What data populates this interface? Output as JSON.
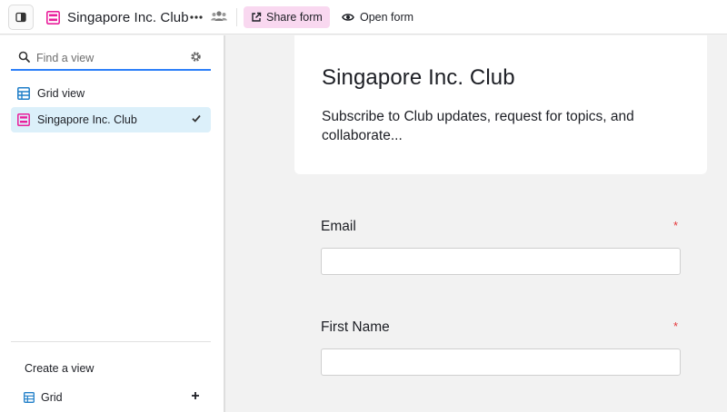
{
  "topbar": {
    "title": "Singapore Inc. Club",
    "share_label": "Share form",
    "open_label": "Open form"
  },
  "sidebar": {
    "search_placeholder": "Find a view",
    "views": [
      {
        "label": "Grid view",
        "icon": "grid-icon",
        "active": false
      },
      {
        "label": "Singapore Inc. Club",
        "icon": "form-icon",
        "active": true
      }
    ],
    "create_title": "Create a view",
    "create_items": [
      {
        "label": "Grid",
        "icon": "grid-icon"
      }
    ]
  },
  "form": {
    "title": "Singapore Inc. Club",
    "description": "Subscribe to Club updates, request for topics, and collaborate...",
    "fields": [
      {
        "label": "Email",
        "required_mark": "*",
        "value": ""
      },
      {
        "label": "First Name",
        "required_mark": "*",
        "value": ""
      }
    ]
  },
  "colors": {
    "accent_blue": "#2d7ff9",
    "form_pink": "#e91e9b",
    "share_bg": "#f9d8f0",
    "active_bg": "#dcf0fa",
    "required_red": "#e5383b"
  }
}
